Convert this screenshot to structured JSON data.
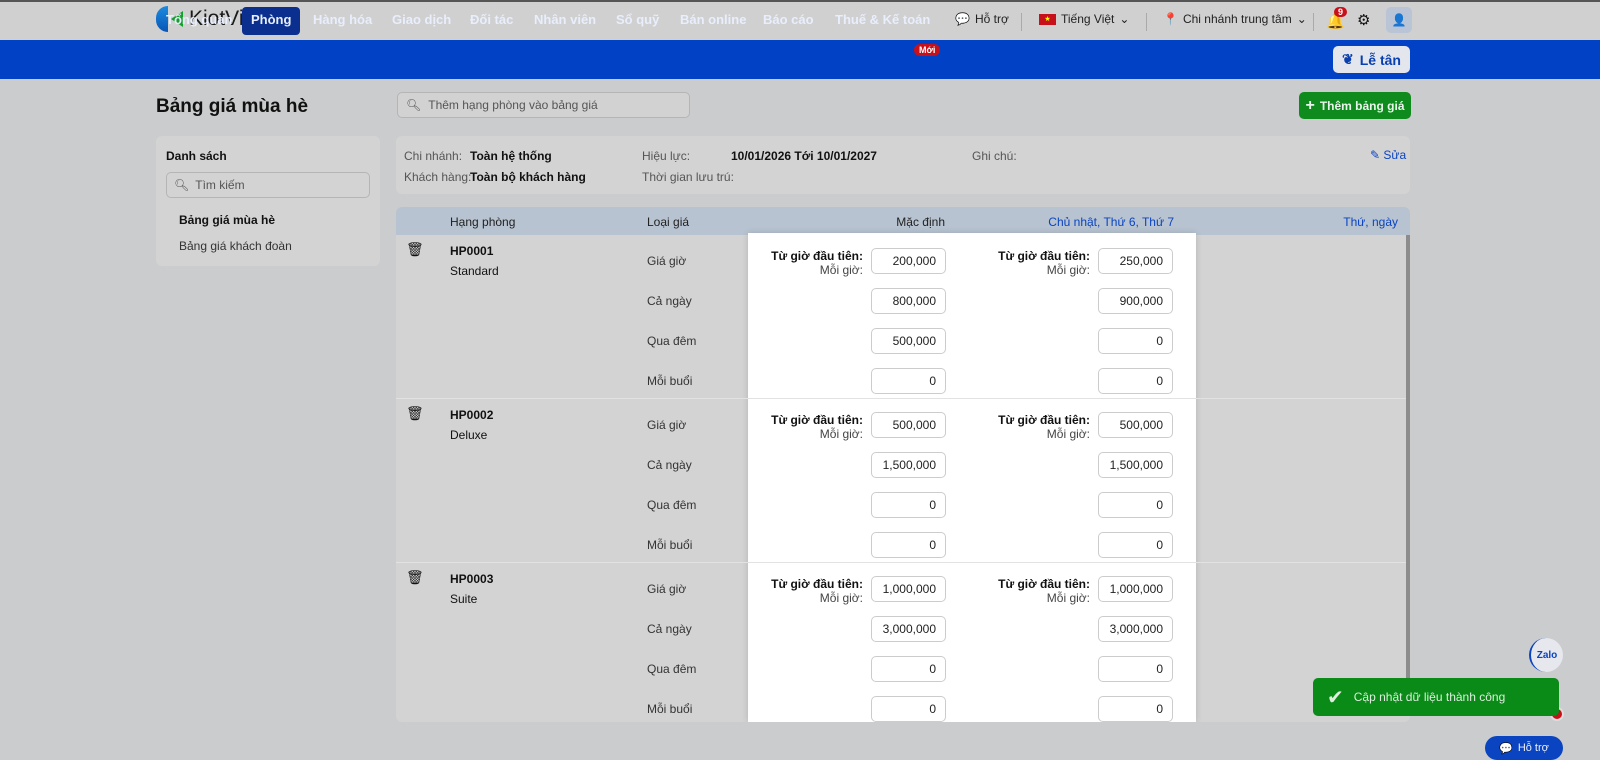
{
  "app": {
    "logo": "KiotViet"
  },
  "topbar": {
    "support": "Hỗ trợ",
    "language": "Tiếng Việt",
    "branch": "Chi nhánh trung tâm",
    "notification_count": "9"
  },
  "nav": {
    "items": [
      "Tổng quan",
      "Phòng",
      "Hàng hóa",
      "Giao dịch",
      "Đối tác",
      "Nhân viên",
      "Sổ quỹ",
      "Bán online",
      "Báo cáo",
      "Thuế & Kế toán"
    ],
    "new_badge": "Mới",
    "reception": "Lễ tân"
  },
  "page": {
    "title": "Bảng giá mùa hè",
    "search_placeholder": "Thêm hạng phòng vào bảng giá",
    "add_button": "Thêm bảng giá"
  },
  "sidebar": {
    "heading": "Danh sách",
    "search_placeholder": "Tìm kiếm",
    "items": [
      "Bảng giá mùa hè",
      "Bảng giá khách đoàn"
    ]
  },
  "info": {
    "branch_label": "Chi nhánh:",
    "branch": "Toàn hệ thống",
    "customer_label": "Khách hàng:",
    "customer": "Toàn bộ khách hàng",
    "validity_label": "Hiệu lực:",
    "validity": "10/01/2026 Tới 10/01/2027",
    "stay_label": "Thời gian lưu trú:",
    "note_label": "Ghi chú:",
    "edit": "Sửa"
  },
  "table": {
    "headers": [
      "Hạng phòng",
      "Loại giá",
      "Mặc định",
      "Chủ nhật, Thứ 6, Thứ 7",
      "Thứ, ngày"
    ],
    "first_hour_label": "Từ giờ đầu tiên:",
    "per_hour_label": "Mỗi giờ:",
    "price_types": [
      "Giá giờ",
      "Cả ngày",
      "Qua đêm",
      "Mỗi buổi"
    ],
    "rooms": [
      {
        "code": "HP0001",
        "name": "Standard",
        "default": [
          "200,000",
          "800,000",
          "500,000",
          "0"
        ],
        "weekend": [
          "250,000",
          "900,000",
          "0",
          "0"
        ]
      },
      {
        "code": "HP0002",
        "name": "Deluxe",
        "default": [
          "500,000",
          "1,500,000",
          "0",
          "0"
        ],
        "weekend": [
          "500,000",
          "1,500,000",
          "0",
          "0"
        ]
      },
      {
        "code": "HP0003",
        "name": "Suite",
        "default": [
          "1,000,000",
          "3,000,000",
          "0",
          "0"
        ],
        "weekend": [
          "1,000,000",
          "3,000,000",
          "0",
          "0"
        ]
      }
    ]
  },
  "toast": {
    "message": "Cập nhật dữ liệu thành công"
  },
  "widgets": {
    "zalo": "Zalo",
    "support": "Hỗ trợ"
  }
}
